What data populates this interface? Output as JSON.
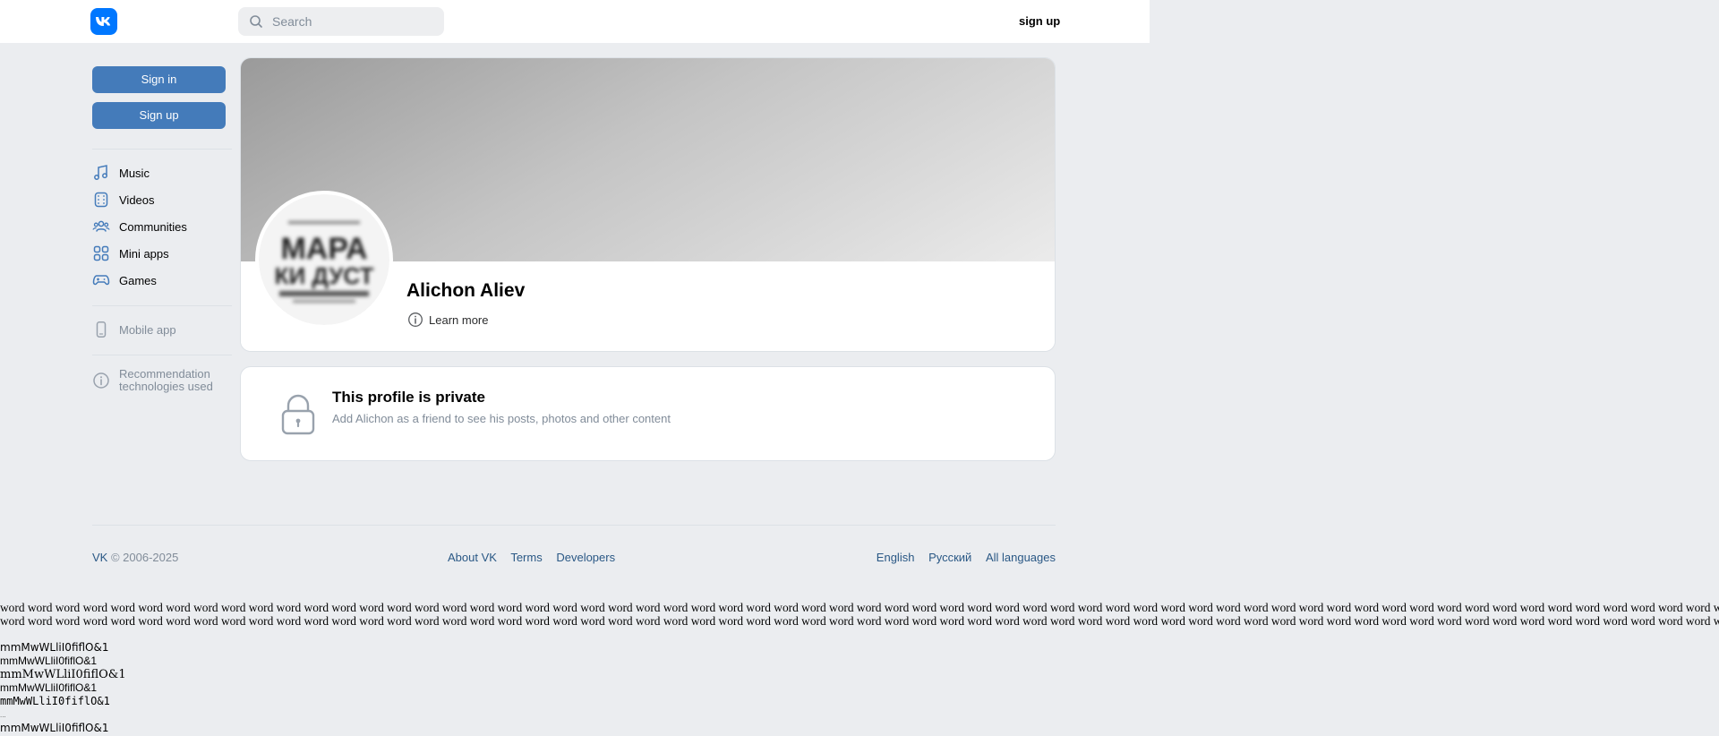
{
  "header": {
    "search_placeholder": "Search",
    "signup_label": "sign up"
  },
  "sidebar": {
    "signin_label": "Sign in",
    "signup_label": "Sign up",
    "items": [
      {
        "label": "Music",
        "icon": "music-icon"
      },
      {
        "label": "Videos",
        "icon": "video-icon"
      },
      {
        "label": "Communities",
        "icon": "users-icon"
      },
      {
        "label": "Mini apps",
        "icon": "apps-icon"
      },
      {
        "label": "Games",
        "icon": "gamepad-icon"
      }
    ],
    "mobile_app_label": "Mobile app",
    "recommendation_line1": "Recommendation",
    "recommendation_line2": "technologies used"
  },
  "profile": {
    "name": "Alichon Aliev",
    "learn_more_label": "Learn more",
    "avatar_text_line1": "МАРА",
    "avatar_text_line2": "КИ ДУСТ"
  },
  "private": {
    "title": "This profile is private",
    "subtitle": "Add Alichon as a friend to see his posts, photos and other content"
  },
  "footer": {
    "brand": "VK",
    "copyright": "© 2006-2025",
    "links": [
      "About VK",
      "Terms",
      "Developers"
    ],
    "languages": [
      "English",
      "Русский",
      "All languages"
    ]
  },
  "filler": {
    "word_line": "word word word word word word word word word word word word word word word word word word word word word word word word word word word word word word word word word word word word word word word word word word word word word word word word word word word word word word word word word word word word word word word word word word word word word",
    "font_test": "mmMwWLliI0fiflO&1",
    "font_test_short": "..."
  },
  "colors": {
    "accent": "#447bba",
    "link": "#2a5885",
    "brand": "#0077ff",
    "background": "#ebedf0"
  }
}
